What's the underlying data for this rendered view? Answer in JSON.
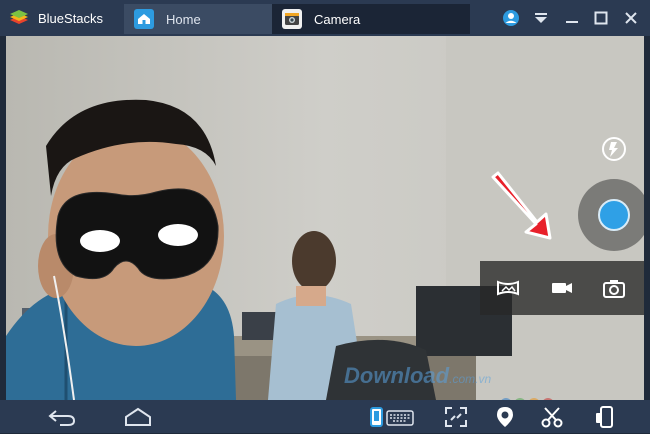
{
  "app": {
    "brand_name": "BlueStacks"
  },
  "tabs": [
    {
      "label": "Home",
      "icon": "home-icon"
    },
    {
      "label": "Camera",
      "icon": "camera-app-icon"
    }
  ],
  "window_controls": [
    "account-icon",
    "menu-dropdown-icon",
    "minimize-icon",
    "maximize-icon",
    "close-icon"
  ],
  "camera": {
    "mode_buttons": [
      "panorama-icon",
      "video-camera-icon",
      "photo-camera-icon"
    ],
    "shutter_color": "#2fa0e6",
    "watermark": {
      "main": "Download",
      "sub": ".com.vn"
    }
  },
  "bottom_nav": [
    "back-icon",
    "home-outline-icon",
    "keyboard-toggle-icon",
    "fullscreen-icon",
    "location-icon",
    "scissors-icon",
    "device-rotate-icon"
  ],
  "colors": {
    "titlebar": "#2b3a52",
    "accent_blue": "#2fa0e6",
    "annotation_arrow": "#e8202a"
  }
}
